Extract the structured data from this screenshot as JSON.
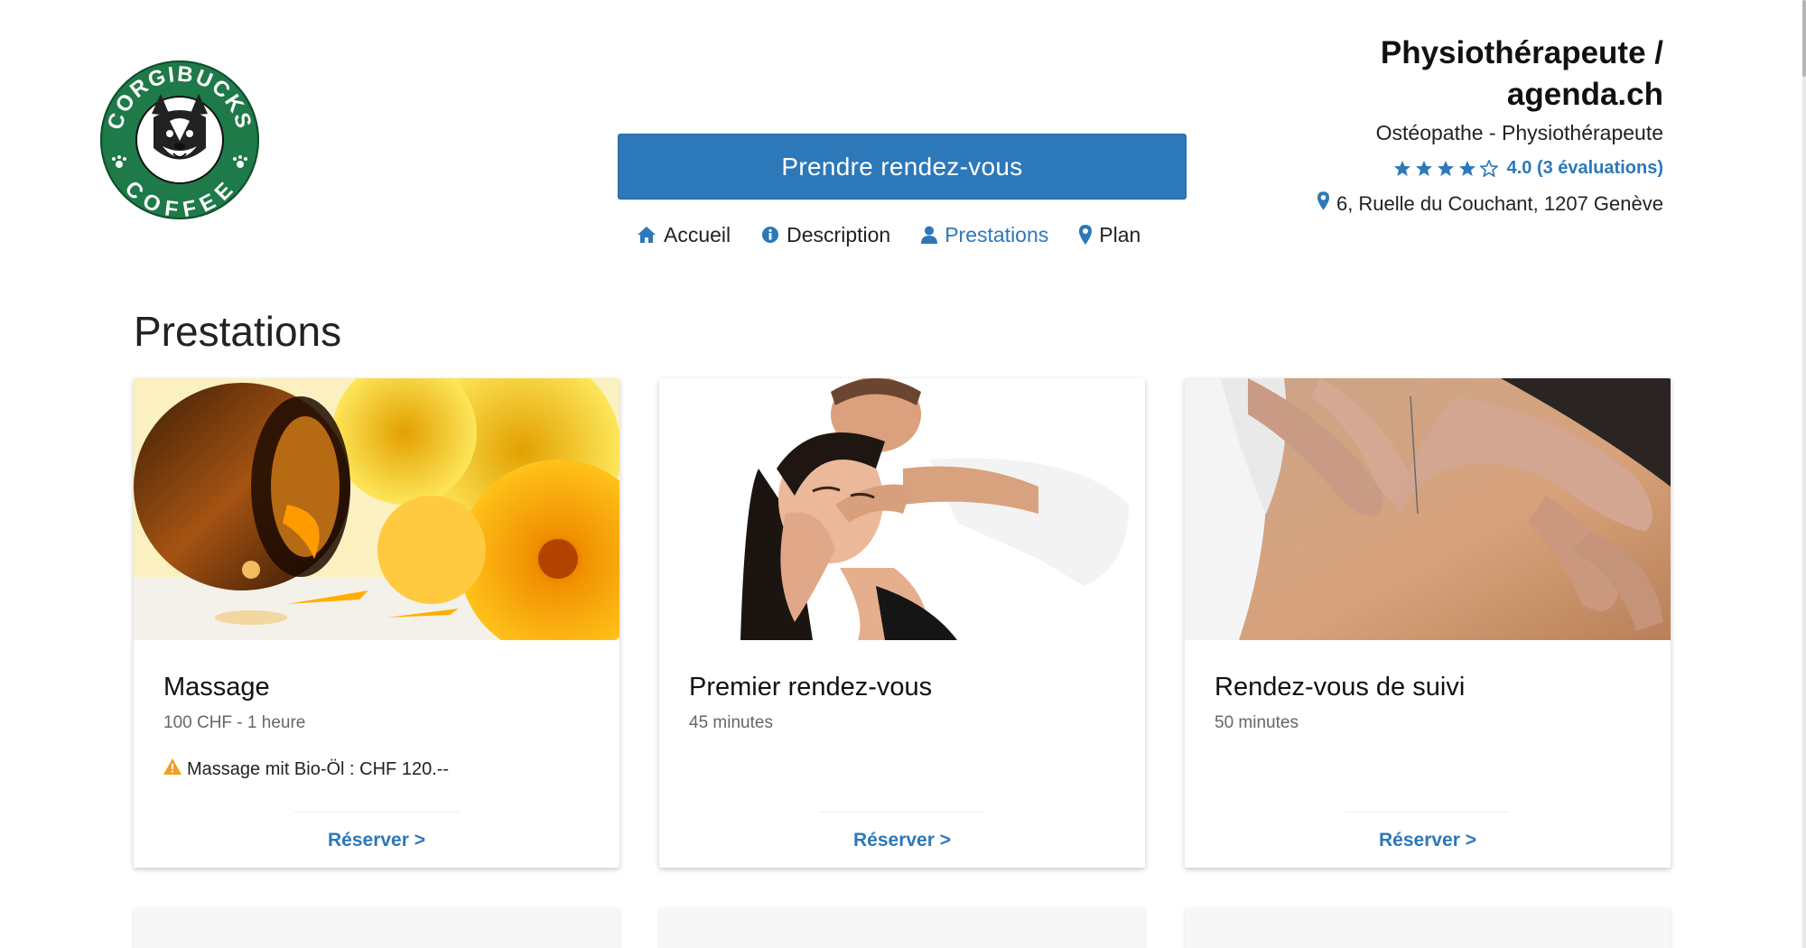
{
  "brand": {
    "logo_text_top": "CORGIBUCKS",
    "logo_text_bottom": "COFFEE",
    "logo_color": "#1e7a48"
  },
  "header": {
    "cta_label": "Prendre rendez-vous",
    "nav": [
      {
        "label": "Accueil",
        "icon": "home-icon",
        "active": false
      },
      {
        "label": "Description",
        "icon": "info-icon",
        "active": false
      },
      {
        "label": "Prestations",
        "icon": "user-icon",
        "active": true
      },
      {
        "label": "Plan",
        "icon": "map-pin-icon",
        "active": false
      }
    ]
  },
  "business": {
    "name_line1": "Physiothérapeute /",
    "name_line2": "agenda.ch",
    "category": "Ostéopathe - Physiothérapeute",
    "rating_value": 4.0,
    "rating_text": "4.0 (3 évaluations)",
    "stars_filled": 4,
    "stars_total": 5,
    "address": "6, Ruelle du Couchant, 1207 Genève"
  },
  "services": {
    "title": "Prestations",
    "reserve_label": "Réserver >",
    "items": [
      {
        "title": "Massage",
        "meta": "100 CHF - 1 heure",
        "note": "Massage mit Bio-Öl : CHF 120.--",
        "image": "oil-flowers"
      },
      {
        "title": "Premier rendez-vous",
        "meta": "45 minutes",
        "note": "",
        "image": "neck-treatment"
      },
      {
        "title": "Rendez-vous de suivi",
        "meta": "50 minutes",
        "note": "",
        "image": "back-acupuncture"
      }
    ]
  },
  "colors": {
    "accent": "#2c78b9",
    "warning": "#f0a020",
    "text": "#222222",
    "muted": "#666666"
  }
}
